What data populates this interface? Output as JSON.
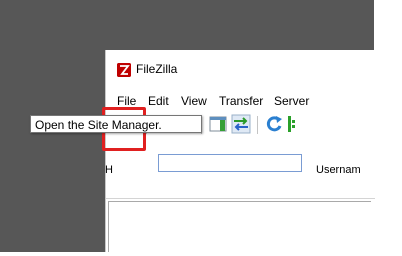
{
  "window": {
    "title": "FileZilla"
  },
  "menu": {
    "items": [
      "File",
      "Edit",
      "View",
      "Transfer",
      "Server"
    ]
  },
  "toolbar": {
    "buttons": [
      {
        "name": "site-manager",
        "icon": "site-manager-icon"
      },
      {
        "name": "site-manager-dropdown",
        "icon": "chevron-down-icon"
      },
      {
        "name": "toggle-message-log",
        "icon": "message-log-icon"
      },
      {
        "name": "toggle-local-tree",
        "icon": "local-tree-icon"
      },
      {
        "name": "toggle-remote-tree",
        "icon": "remote-tree-icon"
      },
      {
        "name": "toggle-transfer-queue",
        "icon": "transfer-queue-icon"
      },
      {
        "name": "refresh",
        "icon": "refresh-icon"
      },
      {
        "name": "process-queue",
        "icon": "process-queue-icon"
      }
    ]
  },
  "quickconnect": {
    "host_label_fragment": "H",
    "username_label": "Usernam"
  },
  "tooltip": {
    "text": "Open the Site Manager."
  },
  "colors": {
    "highlight": "#e02020",
    "desktop": "#575757",
    "logo": "#bf0000"
  }
}
